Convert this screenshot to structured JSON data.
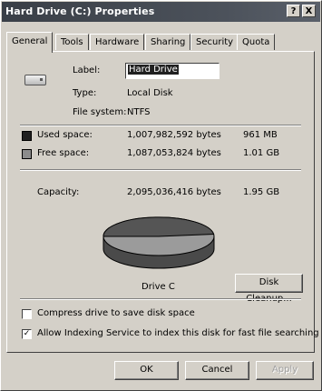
{
  "window": {
    "title": "Hard Drive (C:) Properties",
    "help_button": "?",
    "close_button": "X"
  },
  "tabs": [
    "General",
    "Tools",
    "Hardware",
    "Sharing",
    "Security",
    "Quota"
  ],
  "general": {
    "label_caption": "Label:",
    "label_value": "Hard Drive",
    "type_caption": "Type:",
    "type_value": "Local Disk",
    "filesystem_caption": "File system:",
    "filesystem_value": "NTFS"
  },
  "space": {
    "used": {
      "caption": "Used space:",
      "bytes": "1,007,982,592 bytes",
      "size": "961 MB",
      "color": "#202020"
    },
    "free": {
      "caption": "Free space:",
      "bytes": "1,087,053,824 bytes",
      "size": "1.01 GB",
      "color": "#8c8c8c"
    },
    "capacity": {
      "caption": "Capacity:",
      "bytes": "2,095,036,416 bytes",
      "size": "1.95 GB"
    },
    "used_fraction": 0.481
  },
  "drive_label": "Drive C",
  "disk_cleanup_button": "Disk Cleanup...",
  "options": {
    "compress": {
      "label": "Compress drive to save disk space",
      "checked": false
    },
    "indexing": {
      "label": "Allow Indexing Service to index this disk for fast file searching",
      "checked": true
    }
  },
  "footer": {
    "ok": "OK",
    "cancel": "Cancel",
    "apply": "Apply"
  }
}
